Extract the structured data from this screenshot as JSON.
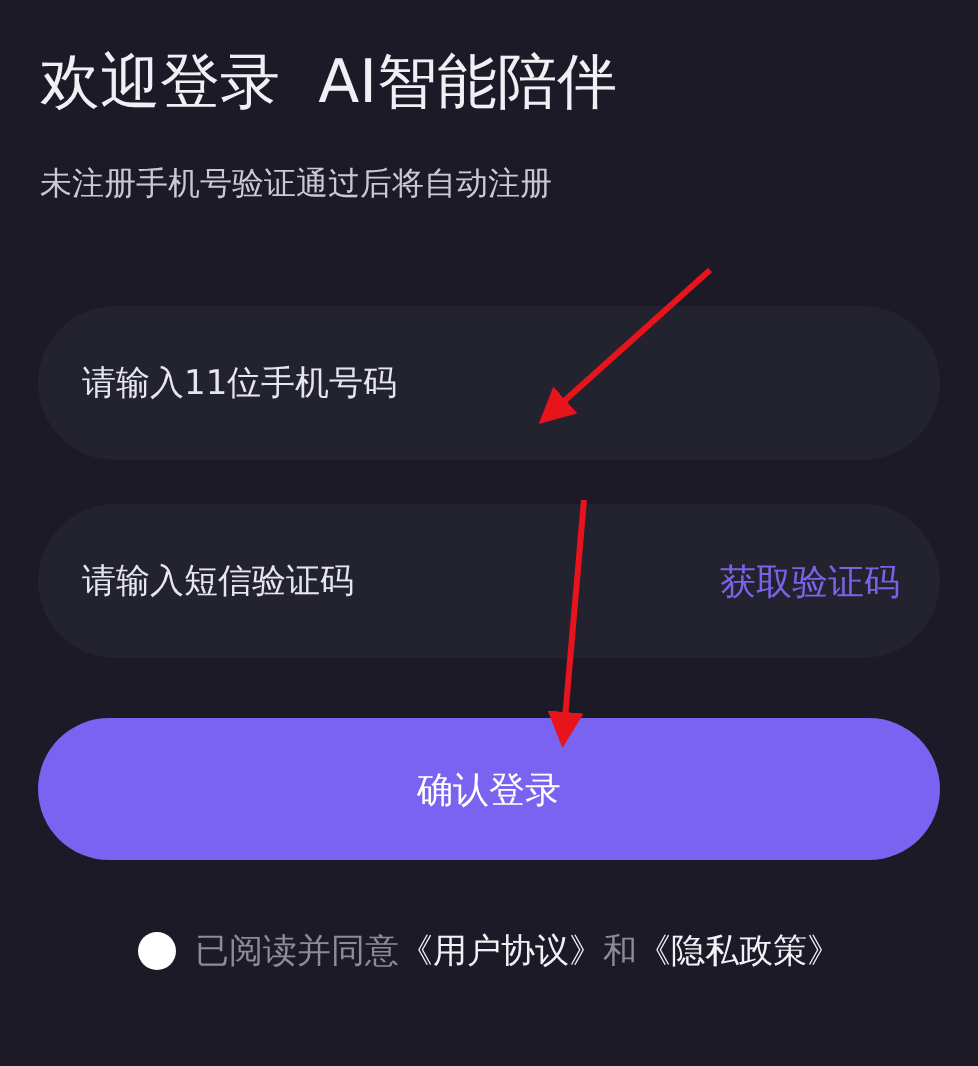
{
  "title": "欢迎登录  AI智能陪伴",
  "subtitle": "未注册手机号验证通过后将自动注册",
  "phone_field": {
    "placeholder": "请输入11位手机号码"
  },
  "code_field": {
    "placeholder": "请输入短信验证码",
    "action": "获取验证码"
  },
  "submit_button": "确认登录",
  "agreement": {
    "checked": false,
    "prefix": "已阅读并同意",
    "links": [
      "《用户协议》",
      "《隐私政策》"
    ],
    "joiner": "和"
  }
}
